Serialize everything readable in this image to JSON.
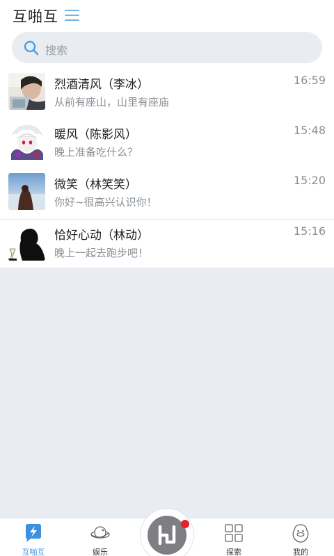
{
  "header": {
    "title": "互啪互"
  },
  "search": {
    "placeholder": "搜索"
  },
  "conversations": [
    {
      "name": "烈酒清风（李冰）",
      "message": "从前有座山，山里有座庙",
      "time": "16:59"
    },
    {
      "name": "暖风（陈影风）",
      "message": "晚上准备吃什么？",
      "time": "15:48"
    },
    {
      "name": "微笑（林笑笑）",
      "message": "你好~很高兴认识你！",
      "time": "15:20"
    },
    {
      "name": "恰好心动（林动）",
      "message": "晚上一起去跑步吧！",
      "time": "15:16"
    }
  ],
  "tabbar": {
    "tabs": [
      {
        "label": "互啪互",
        "icon": "lightning-chat-icon",
        "active": true
      },
      {
        "label": "娱乐",
        "icon": "planet-icon",
        "active": false
      },
      {
        "label": "探索",
        "icon": "grid-icon",
        "active": false
      },
      {
        "label": "我的",
        "icon": "duck-avatar-icon",
        "active": false
      }
    ],
    "center_icon": "app-logo-icon"
  },
  "colors": {
    "accent": "#3d8fe0",
    "menu": "#6cb6e8",
    "background": "#e9edf1",
    "badge": "#e8202a"
  }
}
